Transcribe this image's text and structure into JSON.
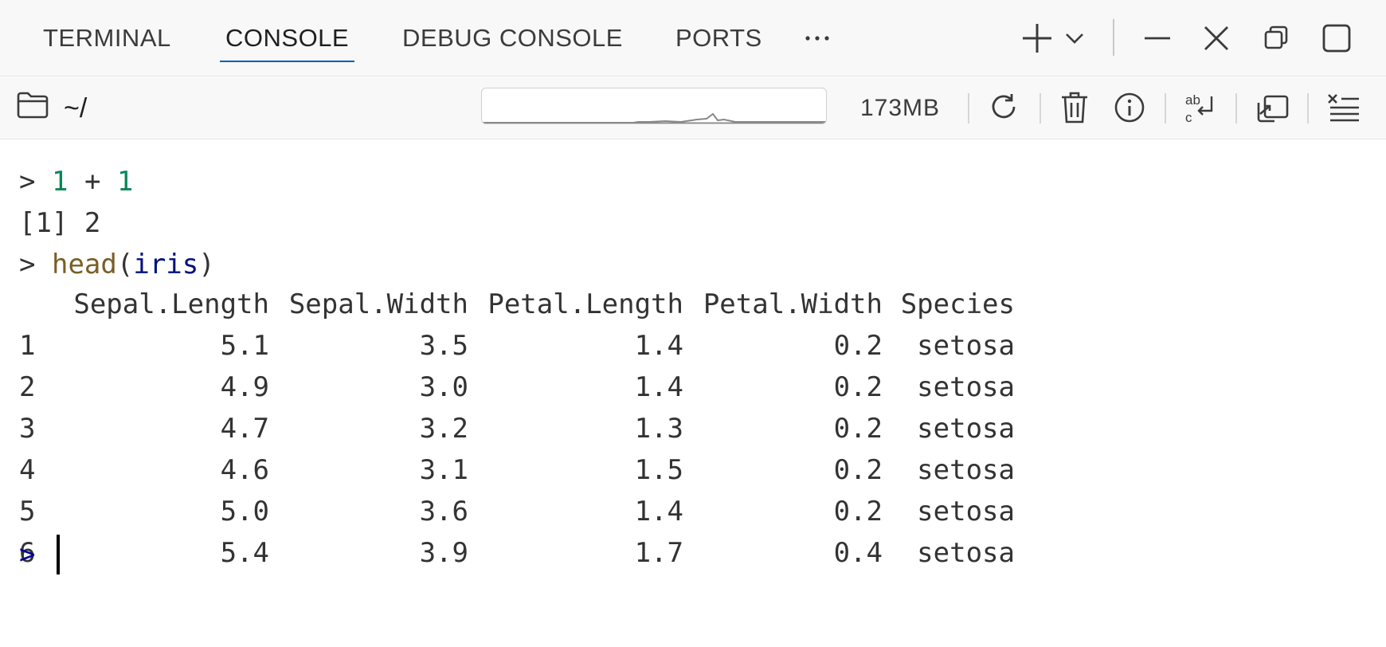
{
  "tabs": [
    {
      "label": "TERMINAL",
      "active": false
    },
    {
      "label": "CONSOLE",
      "active": true
    },
    {
      "label": "DEBUG CONSOLE",
      "active": false
    },
    {
      "label": "PORTS",
      "active": false
    }
  ],
  "tab_icons": [
    "more-horizontal-icon",
    "add-icon",
    "chevron-down-icon",
    "minimize-icon",
    "close-icon",
    "restore-icon",
    "maximize-icon"
  ],
  "toolbar": {
    "cwd": "~/",
    "memory": "173MB",
    "icons": [
      "folder-icon",
      "restart-icon",
      "trash-icon",
      "info-icon",
      "word-wrap-icon",
      "open-in-editor-icon",
      "clear-lines-icon"
    ]
  },
  "console": {
    "cmd1": {
      "prompt": ">",
      "left": "1",
      "op": "+",
      "right": "1"
    },
    "out1": "[1] 2",
    "cmd2": {
      "prompt": ">",
      "fn": "head",
      "open": "(",
      "arg": "iris",
      "close": ")"
    },
    "table": {
      "headers": [
        "",
        "Sepal.Length",
        "Sepal.Width",
        "Petal.Length",
        "Petal.Width",
        "Species"
      ],
      "rows": [
        [
          "1",
          "5.1",
          "3.5",
          "1.4",
          "0.2",
          "setosa"
        ],
        [
          "2",
          "4.9",
          "3.0",
          "1.4",
          "0.2",
          "setosa"
        ],
        [
          "3",
          "4.7",
          "3.2",
          "1.3",
          "0.2",
          "setosa"
        ],
        [
          "4",
          "4.6",
          "3.1",
          "1.5",
          "0.2",
          "setosa"
        ],
        [
          "5",
          "5.0",
          "3.6",
          "1.4",
          "0.2",
          "setosa"
        ],
        [
          "6",
          "5.4",
          "3.9",
          "1.7",
          "0.4",
          "setosa"
        ]
      ]
    },
    "active_prompt": ">"
  },
  "colors": {
    "accent": "#005fb8",
    "number": "#098658",
    "function": "#795e26",
    "variable": "#001080",
    "prompt": "#0000a0"
  }
}
